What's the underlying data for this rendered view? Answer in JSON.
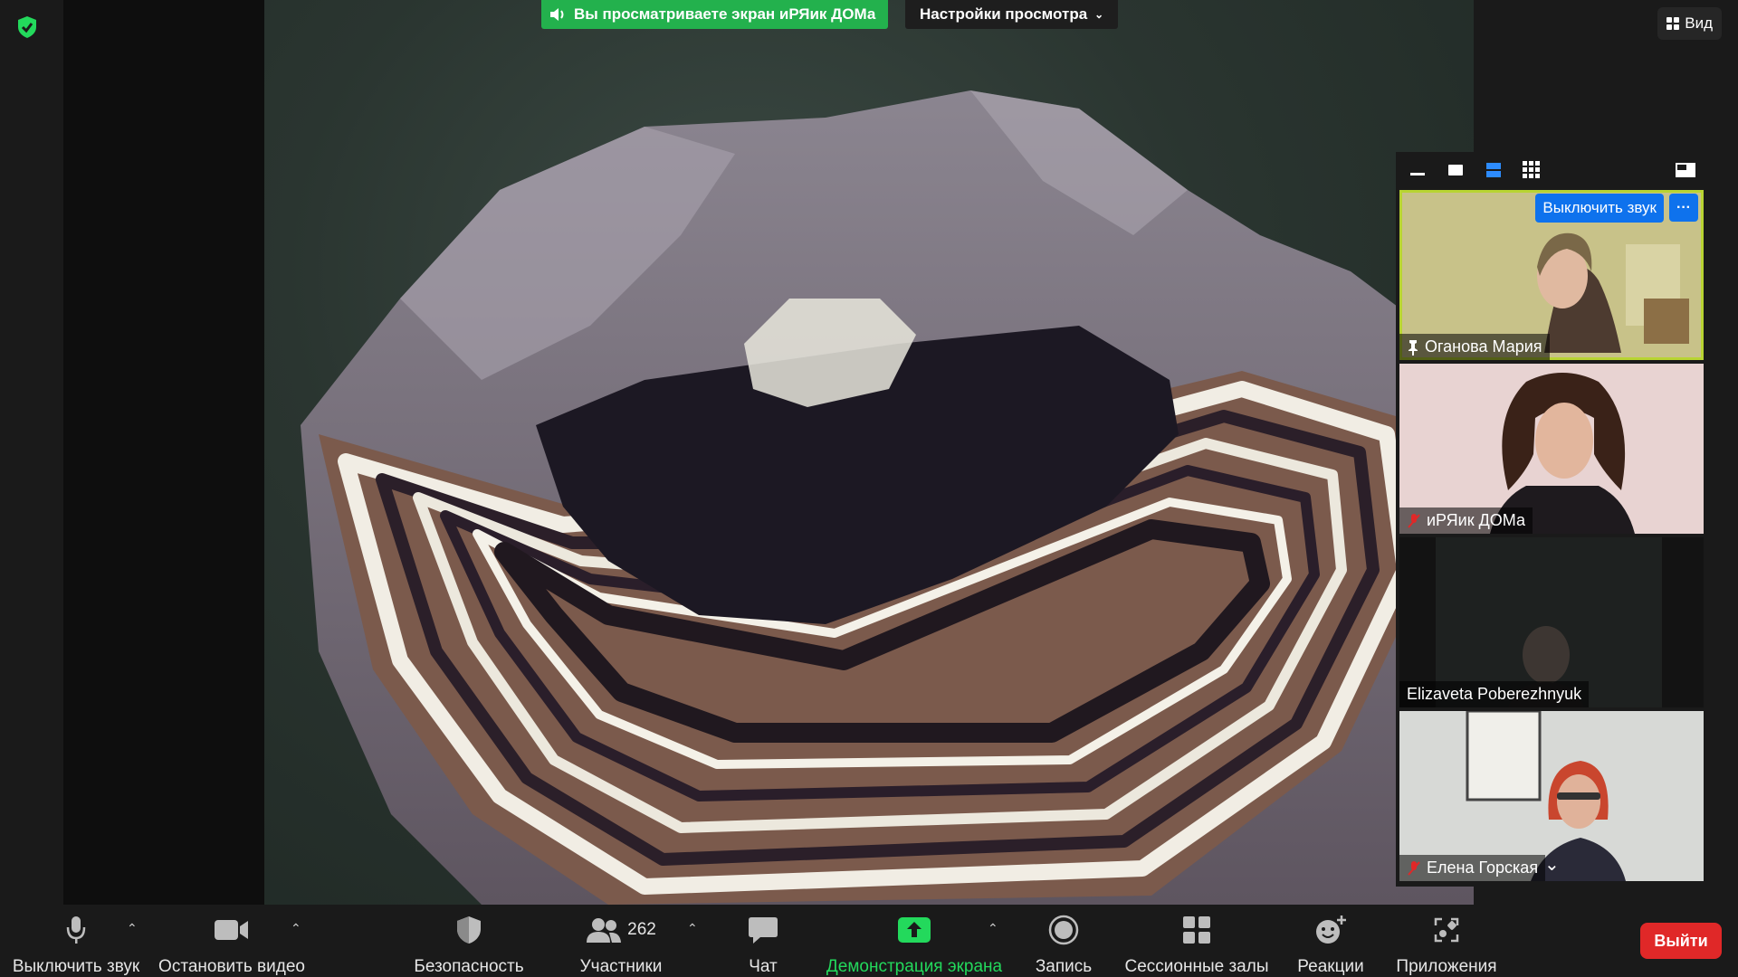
{
  "banner": {
    "viewing_text": "Вы просматриваете экран иРЯик ДОМа",
    "view_options_label": "Настройки просмотра",
    "view_label": "Вид",
    "banner_color": "#23b14d"
  },
  "panel": {
    "toolbar_icons": [
      "minimize-icon",
      "single-view-icon",
      "strip-view-icon",
      "gallery-view-icon",
      "popout-icon"
    ],
    "participants": [
      {
        "name": "Оганова Мария",
        "status": "pinned",
        "active_speaker": true
      },
      {
        "name": "иРЯик ДОМа",
        "status": "muted"
      },
      {
        "name": "Elizaveta Poberezhnyuk",
        "status": ""
      },
      {
        "name": "Елена Горская",
        "status": "muted"
      }
    ],
    "unmute_label": "Выключить звук",
    "more_label": "···"
  },
  "toolbar": {
    "mute_label": "Выключить звук",
    "video_label": "Остановить видео",
    "security_label": "Безопасность",
    "participants_label": "Участники",
    "participants_count": "262",
    "chat_label": "Чат",
    "share_label": "Демонстрация экрана",
    "record_label": "Запись",
    "breakout_label": "Сессионные залы",
    "reactions_label": "Реакции",
    "apps_label": "Приложения",
    "leave_label": "Выйти",
    "share_color": "#23d95c",
    "leave_color": "#e02828"
  }
}
